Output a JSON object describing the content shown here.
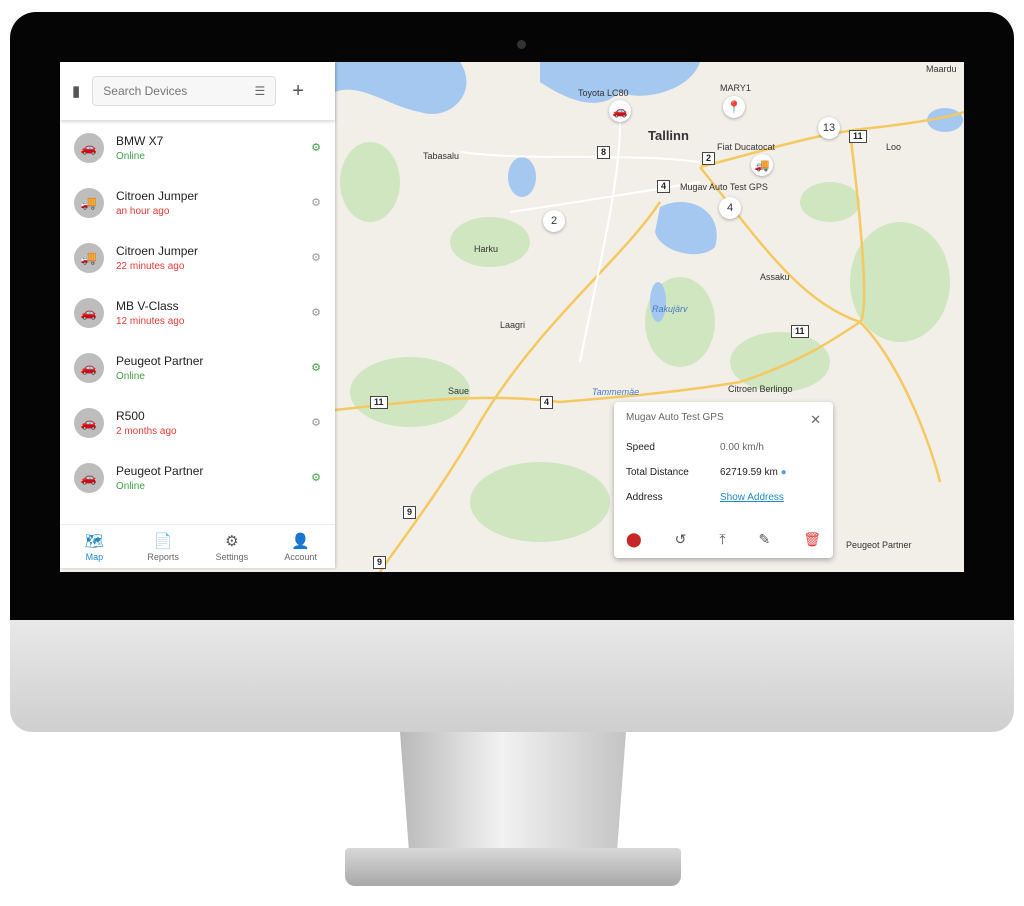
{
  "search": {
    "placeholder": "Search Devices"
  },
  "devices": [
    {
      "name": "BMW X7",
      "status": "Online",
      "online": true,
      "icon": "car-icon"
    },
    {
      "name": "Citroen Jumper",
      "status": "an hour ago",
      "online": false,
      "icon": "truck-icon"
    },
    {
      "name": "Citroen Jumper",
      "status": "22 minutes ago",
      "online": false,
      "icon": "truck-icon"
    },
    {
      "name": "MB V-Class",
      "status": "12 minutes ago",
      "online": false,
      "icon": "car-icon"
    },
    {
      "name": "Peugeot Partner",
      "status": "Online",
      "online": true,
      "icon": "car-icon"
    },
    {
      "name": "R500",
      "status": "2 months ago",
      "online": false,
      "icon": "car-icon"
    },
    {
      "name": "Peugeot Partner",
      "status": "Online",
      "online": true,
      "icon": "car-icon"
    }
  ],
  "nav": {
    "map": "Map",
    "reports": "Reports",
    "settings": "Settings",
    "account": "Account"
  },
  "map": {
    "places": {
      "tallinn": "Tallinn",
      "tabasalu": "Tabasalu",
      "harku": "Harku",
      "laagri": "Laagri",
      "saue": "Saue",
      "assaku": "Assaku",
      "loo": "Loo",
      "maardu": "Maardu",
      "rakujarv": "Rakujärv",
      "tammemae": "Tammemäe"
    },
    "roads": [
      "8",
      "2",
      "4",
      "11",
      "11",
      "11",
      "4",
      "9"
    ],
    "devices": {
      "toyota": "Toyota LC80",
      "mary": "MARY1",
      "fiat": "Fiat Ducatocat",
      "mugav": "Mugav Auto Test GPS",
      "citroen": "Citroen Berlingo",
      "peugeot": "Peugeot Partner"
    },
    "clusters": [
      "13",
      "2",
      "4"
    ]
  },
  "popup": {
    "title": "Mugav Auto Test GPS",
    "speed_label": "Speed",
    "speed": "0.00 km/h",
    "distance_label": "Total Distance",
    "distance": "62719.59 km",
    "address_label": "Address",
    "address_link": "Show Address"
  },
  "colors": {
    "online": "#43a047",
    "offline": "#e53935",
    "accent": "#1e88c7",
    "water": "#a4c8f0"
  }
}
